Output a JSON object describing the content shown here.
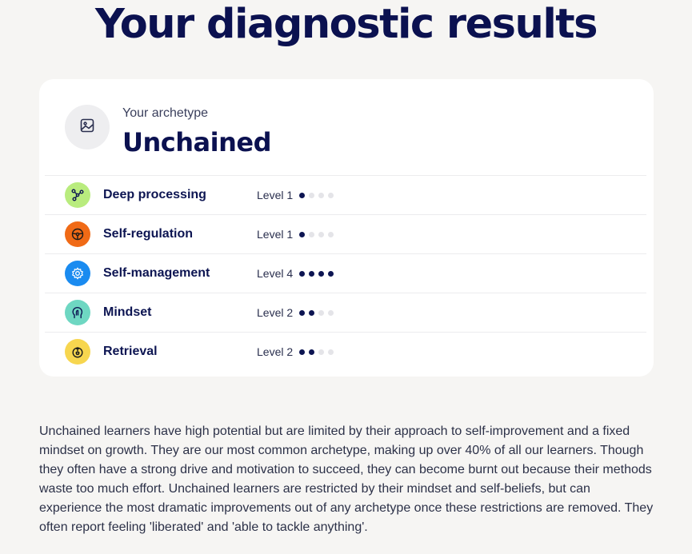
{
  "page": {
    "title": "Your diagnostic results"
  },
  "archetype": {
    "label": "Your archetype",
    "name": "Unchained",
    "icon": "image-icon"
  },
  "skills": [
    {
      "name": "Deep processing",
      "level_label": "Level 1",
      "level": 1,
      "max_level": 4,
      "icon": "network-nodes-icon",
      "color": "#b9ec7e"
    },
    {
      "name": "Self-regulation",
      "level_label": "Level 1",
      "level": 1,
      "max_level": 4,
      "icon": "steering-wheel-icon",
      "color": "#f06a16"
    },
    {
      "name": "Self-management",
      "level_label": "Level 4",
      "level": 4,
      "max_level": 4,
      "icon": "gear-icon",
      "color": "#1a8bf0"
    },
    {
      "name": "Mindset",
      "level_label": "Level 2",
      "level": 2,
      "max_level": 4,
      "icon": "head-brain-icon",
      "color": "#6ed7c2"
    },
    {
      "name": "Retrieval",
      "level_label": "Level 2",
      "level": 2,
      "max_level": 4,
      "icon": "hand-gesture-icon",
      "color": "#f7d64f"
    }
  ],
  "description": "Unchained learners have high potential but are limited by their approach to self-improvement and a fixed mindset on growth. They are our most common archetype, making up over 40% of all our learners. Though they often have a strong drive and motivation to succeed, they can become burnt out because their methods waste too much effort. Unchained learners are restricted by their mindset and self-beliefs, but can experience the most dramatic improvements out of any archetype once these restrictions are removed. They often report feeling 'liberated' and 'able to tackle anything'.",
  "colors": {
    "title": "#0b1150",
    "dot_on": "#0d1552",
    "dot_off": "#e4e4e8",
    "card_bg": "#ffffff",
    "page_bg": "#f6f5f3"
  }
}
